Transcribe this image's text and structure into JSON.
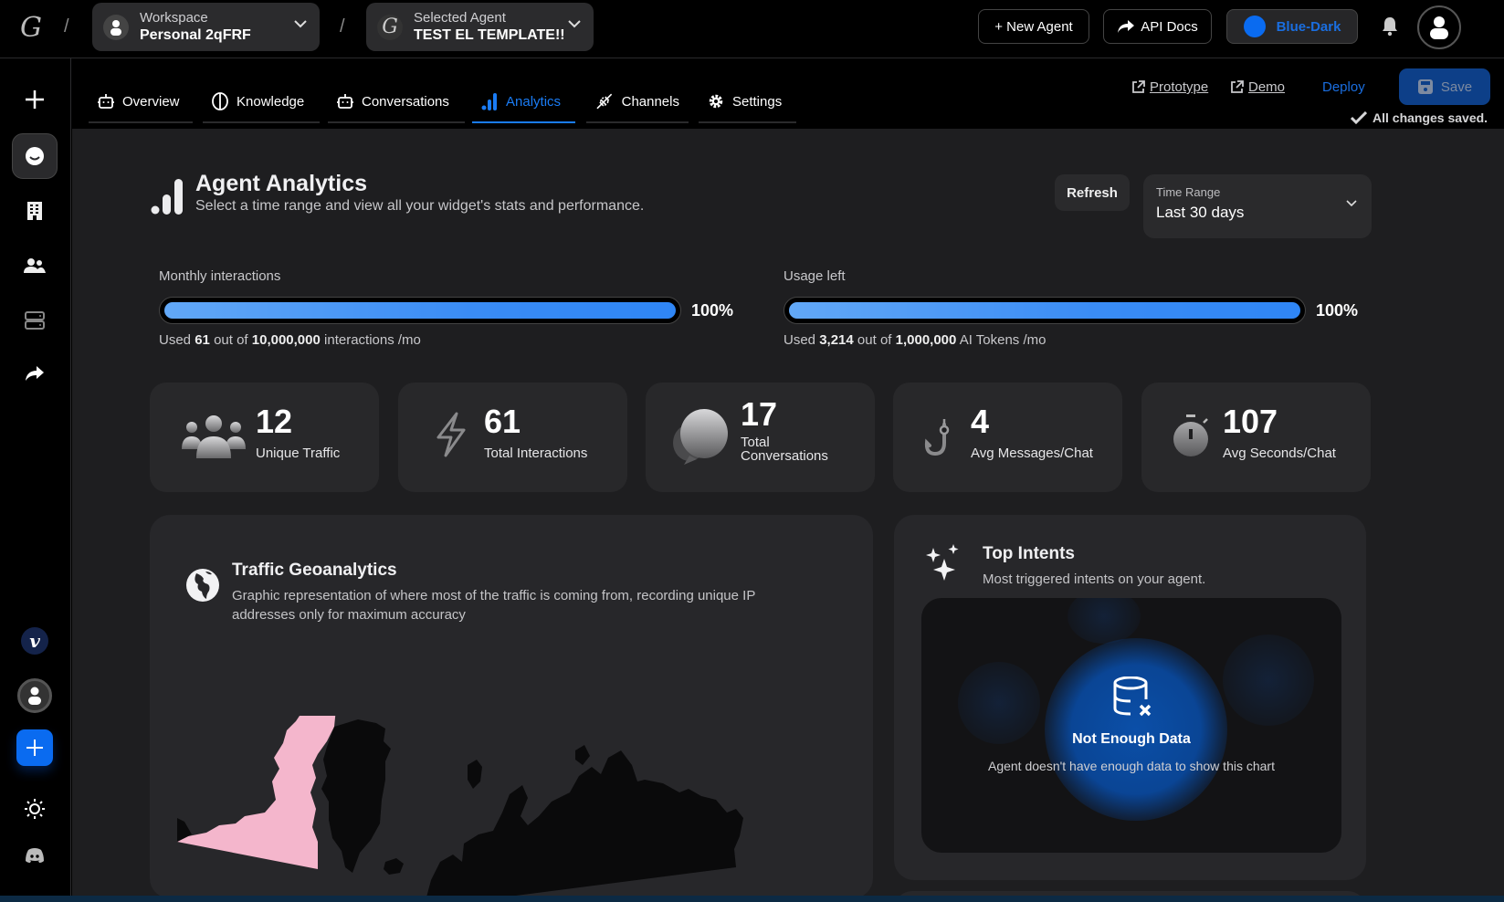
{
  "topbar": {
    "workspace_label": "Workspace",
    "workspace_value": "Personal 2qFRF",
    "agent_label": "Selected Agent",
    "agent_value": "TEST EL TEMPLATE!!",
    "new_agent": "+ New Agent",
    "api_docs": "API Docs",
    "theme": "Blue-Dark",
    "theme_color": "#0a6bf0"
  },
  "tabs": [
    {
      "label": "Overview",
      "icon": "robot-icon"
    },
    {
      "label": "Knowledge",
      "icon": "brain-icon"
    },
    {
      "label": "Conversations",
      "icon": "robot-icon"
    },
    {
      "label": "Analytics",
      "icon": "bar-chart-icon",
      "active": true
    },
    {
      "label": "Channels",
      "icon": "plug-icon"
    },
    {
      "label": "Settings",
      "icon": "gear-icon"
    }
  ],
  "actions": {
    "prototype": "Prototype",
    "demo": "Demo",
    "deploy": "Deploy",
    "save": "Save",
    "status": "All changes saved."
  },
  "header": {
    "title": "Agent Analytics",
    "subtitle": "Select a time range and view all your widget's stats and performance.",
    "refresh": "Refresh",
    "time_range_label": "Time Range",
    "time_range_value": "Last 30 days"
  },
  "usage": [
    {
      "label": "Monthly interactions",
      "percent": 100,
      "percent_text": "100%",
      "used_prefix": "Used",
      "used": "61",
      "middle": "out of",
      "total": "10,000,000",
      "unit": "interactions /mo"
    },
    {
      "label": "Usage left",
      "percent": 100,
      "percent_text": "100%",
      "used_prefix": "Used",
      "used": "3,214",
      "middle": "out of",
      "total": "1,000,000",
      "unit": "AI Tokens /mo"
    }
  ],
  "stats": [
    {
      "value": "12",
      "label": "Unique Traffic",
      "icon": "users-icon"
    },
    {
      "value": "61",
      "label": "Total Interactions",
      "icon": "lightning-icon"
    },
    {
      "value": "17",
      "label": "Total Conversations",
      "icon": "chat-bubbles-icon"
    },
    {
      "value": "4",
      "label": "Avg Messages/Chat",
      "icon": "hook-icon"
    },
    {
      "value": "107",
      "label": "Avg Seconds/Chat",
      "icon": "stopwatch-icon"
    }
  ],
  "geo": {
    "title": "Traffic Geoanalytics",
    "subtitle": "Graphic representation of where most of the traffic is coming from, recording unique IP addresses only for maximum accuracy",
    "highlight_color": "#f4b6cc"
  },
  "intents": {
    "title": "Top Intents",
    "subtitle": "Most triggered intents on your agent.",
    "empty_title": "Not Enough Data",
    "empty_sub": "Agent doesn't have enough data to show this chart"
  }
}
